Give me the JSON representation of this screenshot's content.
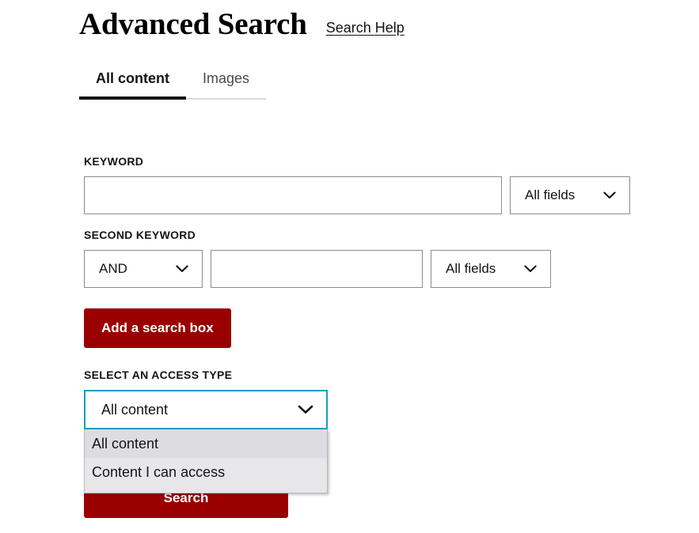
{
  "header": {
    "title": "Advanced Search",
    "help_link": "Search Help"
  },
  "tabs": [
    {
      "label": "All content",
      "active": true
    },
    {
      "label": "Images",
      "active": false
    }
  ],
  "form": {
    "keyword": {
      "label": "KEYWORD",
      "value": "",
      "placeholder": "",
      "field_scope": "All fields"
    },
    "second_keyword": {
      "label": "SECOND KEYWORD",
      "operator": "AND",
      "value": "",
      "placeholder": "",
      "field_scope": "All fields"
    },
    "add_search_box_button": "Add a search box",
    "access_type": {
      "label": "SELECT AN ACCESS TYPE",
      "selected": "All content",
      "options": [
        {
          "label": "All content",
          "selected": true
        },
        {
          "label": "Content I can access",
          "selected": false
        }
      ]
    },
    "submit_button": "Search"
  },
  "icons": {
    "chevron_down": "chevron-down-icon"
  },
  "colors": {
    "brand_red": "#9b0000",
    "focus_border": "#1a9cc4",
    "tab_active_underline": "#141414",
    "dropdown_bg": "#e7e7ea",
    "dropdown_selected_bg": "#dcdce1"
  }
}
